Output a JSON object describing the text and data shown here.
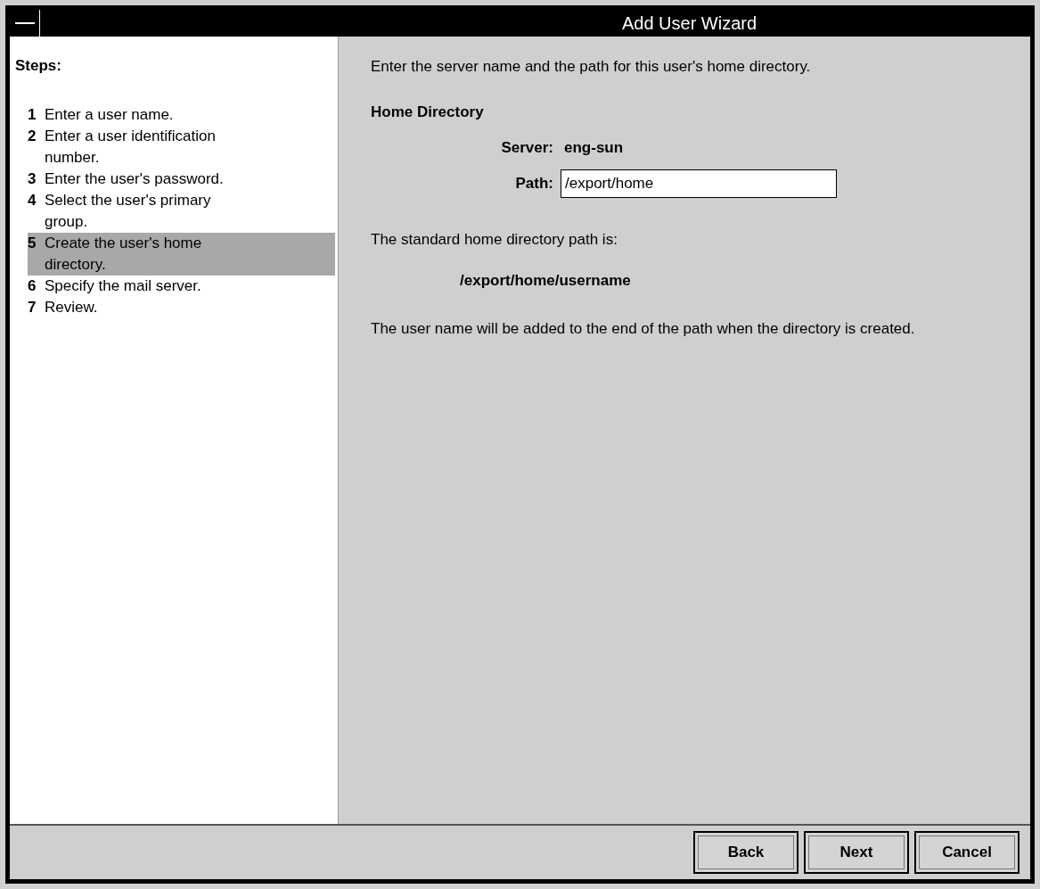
{
  "window": {
    "title": "Add User Wizard"
  },
  "steps_heading": "Steps:",
  "steps": [
    {
      "number": "1",
      "label": "Enter a user name.",
      "selected": false
    },
    {
      "number": "2",
      "label": "Enter a user identification number.",
      "selected": false
    },
    {
      "number": "3",
      "label": "Enter the user's password.",
      "selected": false
    },
    {
      "number": "4",
      "label": "Select the user's primary group.",
      "selected": false
    },
    {
      "number": "5",
      "label": "Create the user's home directory.",
      "selected": true
    },
    {
      "number": "6",
      "label": "Specify the mail server.",
      "selected": false
    },
    {
      "number": "7",
      "label": "Review.",
      "selected": false
    }
  ],
  "intro": "Enter the server name and the path for this user's home directory.",
  "section_heading": "Home Directory",
  "server": {
    "label": "Server:",
    "value": "eng-sun"
  },
  "path": {
    "label": "Path:",
    "value": "/export/home"
  },
  "standard_note": "The standard home directory path is:",
  "standard_path": "/export/home/username",
  "footnote": "The user name will be added to the end of the path when the directory is created.",
  "buttons": [
    "Back",
    "Next",
    "Cancel"
  ]
}
